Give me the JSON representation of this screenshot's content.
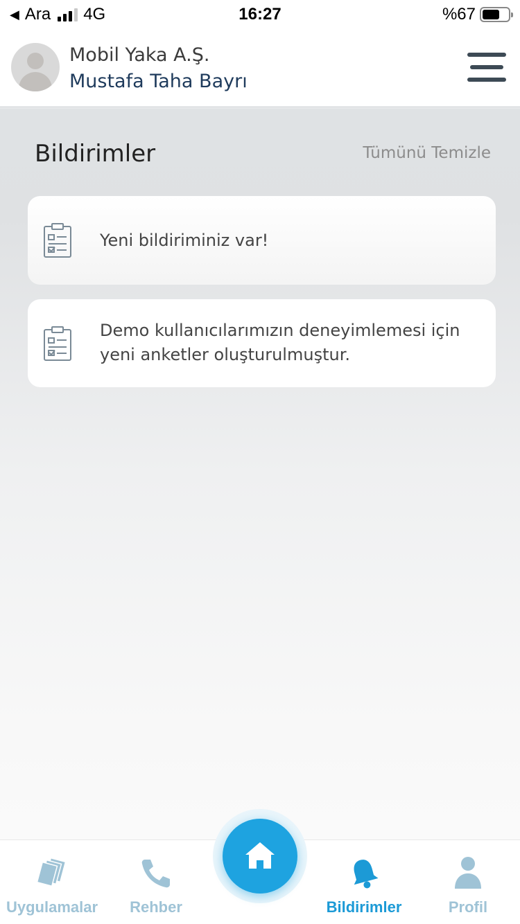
{
  "status_bar": {
    "carrier": "Ara",
    "network": "4G",
    "time": "16:27",
    "battery": "%67",
    "battery_level": 0.67
  },
  "header": {
    "company": "Mobil Yaka A.Ş.",
    "user_name": "Mustafa Taha Bayrı",
    "menu_icon": "hamburger-icon"
  },
  "page": {
    "title": "Bildirimler",
    "clear_all": "Tümünü Temizle"
  },
  "notifications": [
    {
      "icon": "clipboard-checklist-icon",
      "text": "Yeni bildiriminiz var!"
    },
    {
      "icon": "clipboard-checklist-icon",
      "text": "Demo kullanıcılarımızın deneyimlemesi için yeni anketler oluşturulmuştur."
    }
  ],
  "tabs": [
    {
      "label": "Uygulamalar",
      "icon": "documents-icon",
      "active": false
    },
    {
      "label": "Rehber",
      "icon": "phone-icon",
      "active": false
    },
    {
      "label": "Bildirimler",
      "icon": "bell-icon",
      "active": true
    },
    {
      "label": "Profil",
      "icon": "person-icon",
      "active": false
    }
  ],
  "home_button": {
    "icon": "home-icon"
  },
  "colors": {
    "accent": "#1ea3e0",
    "tab_inactive": "#9fc3d6",
    "tab_active": "#1c9ad6",
    "user_name": "#1f3b5c"
  }
}
